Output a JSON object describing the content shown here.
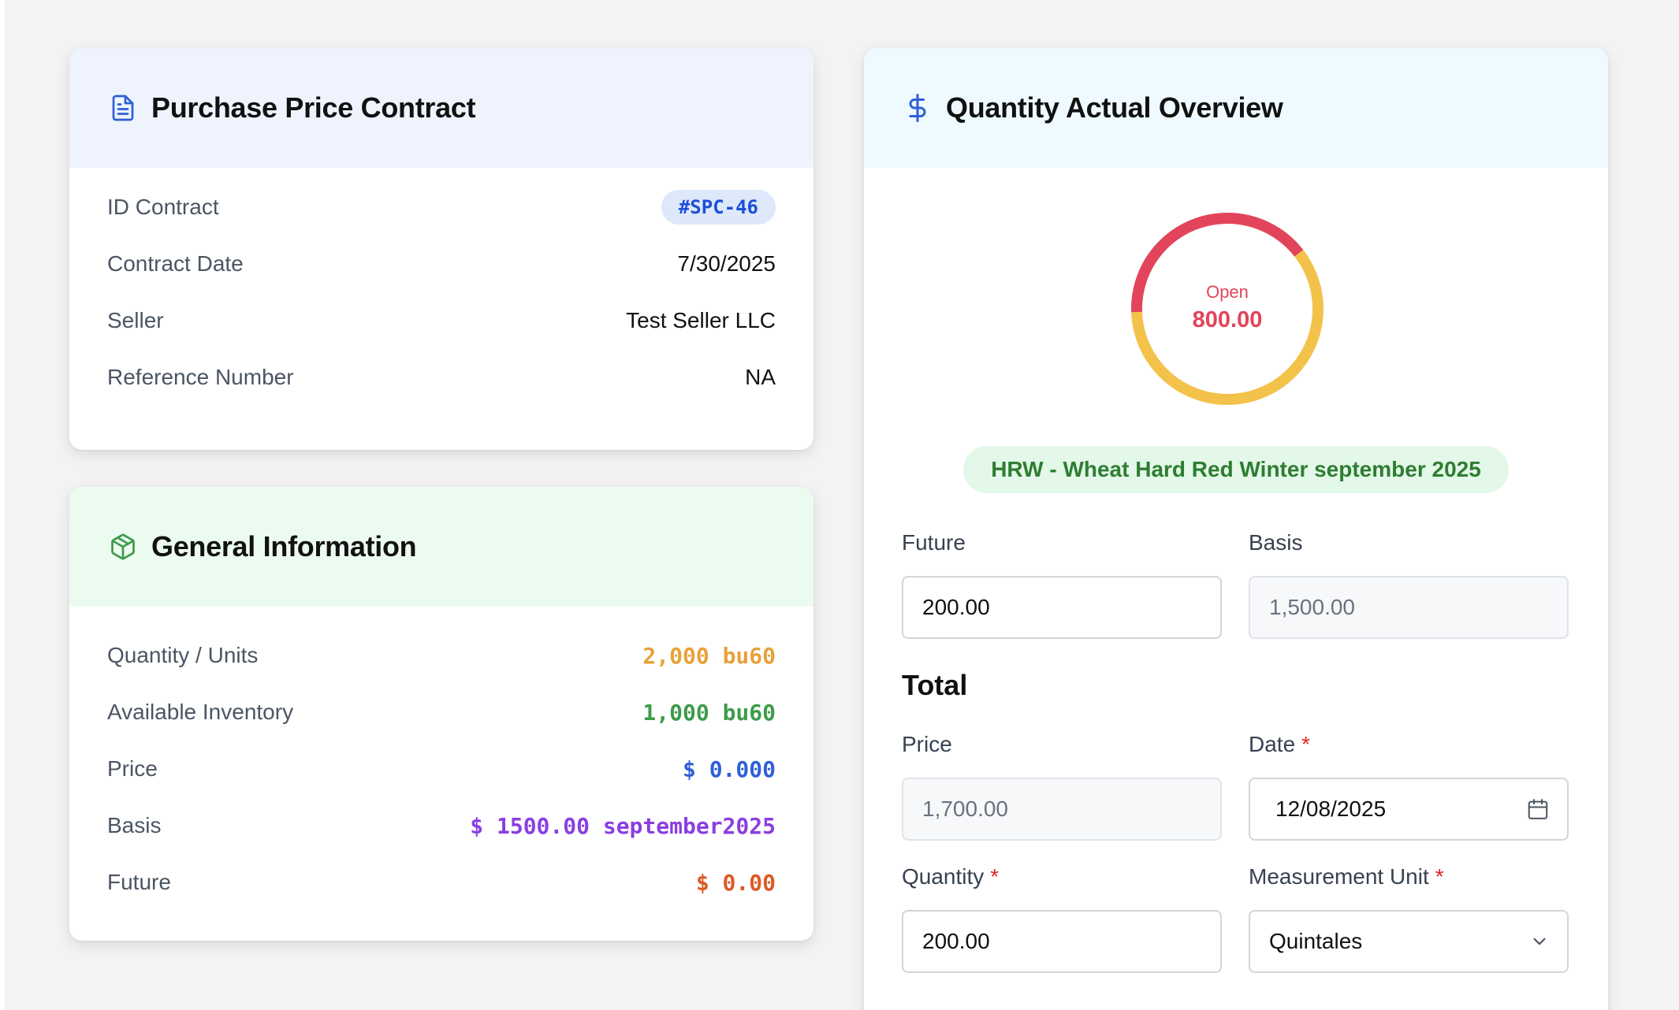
{
  "contract": {
    "title": "Purchase Price Contract",
    "icon": "document-icon",
    "rows": {
      "id_label": "ID Contract",
      "id_value": "#SPC-46",
      "date_label": "Contract Date",
      "date_value": "7/30/2025",
      "seller_label": "Seller",
      "seller_value": "Test Seller LLC",
      "ref_label": "Reference Number",
      "ref_value": "NA"
    }
  },
  "general": {
    "title": "General Information",
    "icon": "package-icon",
    "rows": {
      "quantity_label": "Quantity / Units",
      "quantity_value": "2,000 bu60",
      "inventory_label": "Available Inventory",
      "inventory_value": "1,000 bu60",
      "price_label": "Price",
      "price_value": "$ 0.000",
      "basis_label": "Basis",
      "basis_value": "$ 1500.00 september2025",
      "future_label": "Future",
      "future_value": "$ 0.00"
    }
  },
  "overview": {
    "title": "Quantity Actual Overview",
    "icon": "dollar-icon",
    "donut": {
      "label": "Open",
      "value": "800.00",
      "open_fraction": 0.4,
      "open_color": "#e2445c",
      "rest_color": "#f3c24b"
    },
    "commodity": "HRW - Wheat Hard Red Winter september 2025",
    "future_label": "Future",
    "future_value": "200.00",
    "basis_label": "Basis",
    "basis_value": "1,500.00",
    "total_title": "Total",
    "price_label": "Price",
    "price_value": "1,700.00",
    "date_label": "Date",
    "date_value": "12/08/2025",
    "quantity_label": "Quantity",
    "quantity_value": "200.00",
    "unit_label": "Measurement Unit",
    "unit_value": "Quintales",
    "required_mark": "*"
  },
  "colors": {
    "quantity": "#e8a13a",
    "inventory": "#3d9b4a",
    "price": "#2f5fd6",
    "basis": "#8a3ee0",
    "future": "#dc5a26"
  }
}
